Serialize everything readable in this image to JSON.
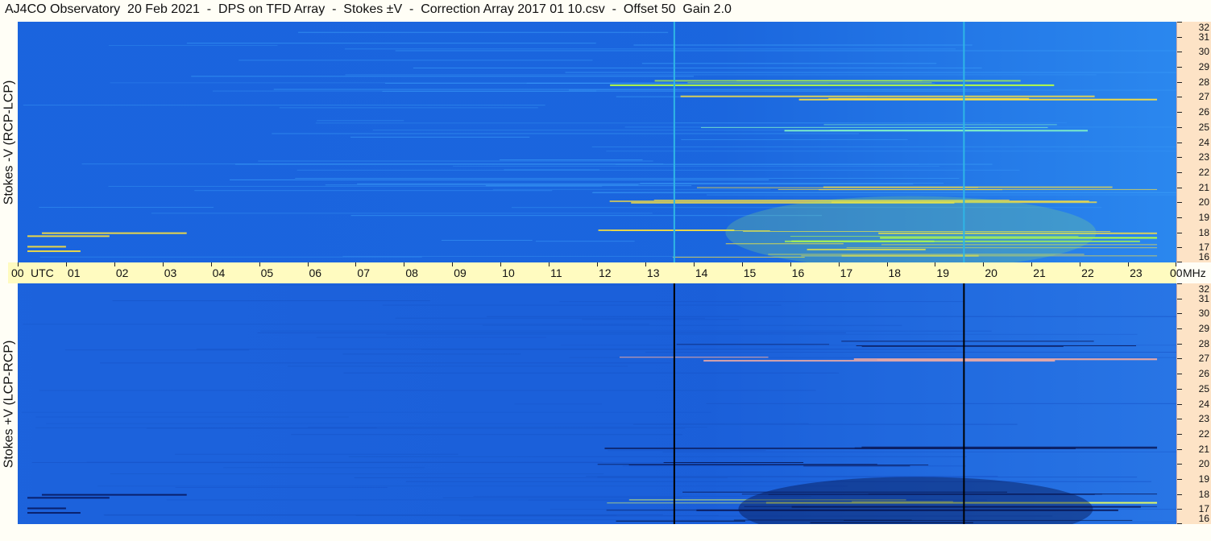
{
  "window": {
    "title": "AJ4CO Observatory  20 Feb 2021  -  DPS on TFD Array  -  Stokes ±V  -  Correction Array 2017 01 10.csv  -  Offset 50  Gain 2.0"
  },
  "chart_data": [
    {
      "type": "heatmap",
      "panel": "upper",
      "ylabel": "Stokes -V (RCP-LCP)",
      "x_ticks": [
        "00",
        "01",
        "02",
        "03",
        "04",
        "05",
        "06",
        "07",
        "08",
        "09",
        "10",
        "11",
        "12",
        "13",
        "14",
        "15",
        "16",
        "17",
        "18",
        "19",
        "20",
        "21",
        "22",
        "23",
        "00"
      ],
      "x_unit": "UTC",
      "y_unit": "MHz",
      "y_ticks": [
        32,
        31,
        30,
        29,
        28,
        27,
        26,
        25,
        24,
        23,
        22,
        21,
        20,
        19,
        18,
        17,
        16
      ],
      "xlim": [
        0,
        24
      ],
      "ylim": [
        16,
        32
      ],
      "vertical_markers_utc": [
        13.6,
        19.6
      ],
      "marker_color": "#2fb6e6",
      "background_color": "#1e6ee6",
      "hot_color": "#ffe23a"
    },
    {
      "type": "heatmap",
      "panel": "lower",
      "ylabel": "Stokes +V (LCP-RCP)",
      "x_ticks": [
        "00",
        "01",
        "02",
        "03",
        "04",
        "05",
        "06",
        "07",
        "08",
        "09",
        "10",
        "11",
        "12",
        "13",
        "14",
        "15",
        "16",
        "17",
        "18",
        "19",
        "20",
        "21",
        "22",
        "23",
        "00"
      ],
      "x_unit": "UTC",
      "y_unit": "MHz",
      "y_ticks": [
        32,
        31,
        30,
        29,
        28,
        27,
        26,
        25,
        24,
        23,
        22,
        21,
        20,
        19,
        18,
        17,
        16
      ],
      "xlim": [
        0,
        24
      ],
      "ylim": [
        16,
        32
      ],
      "vertical_markers_utc": [
        13.6,
        19.6
      ],
      "marker_color": "#000000",
      "background_color": "#1e66e0",
      "hot_color": "#0a1a5a"
    }
  ]
}
